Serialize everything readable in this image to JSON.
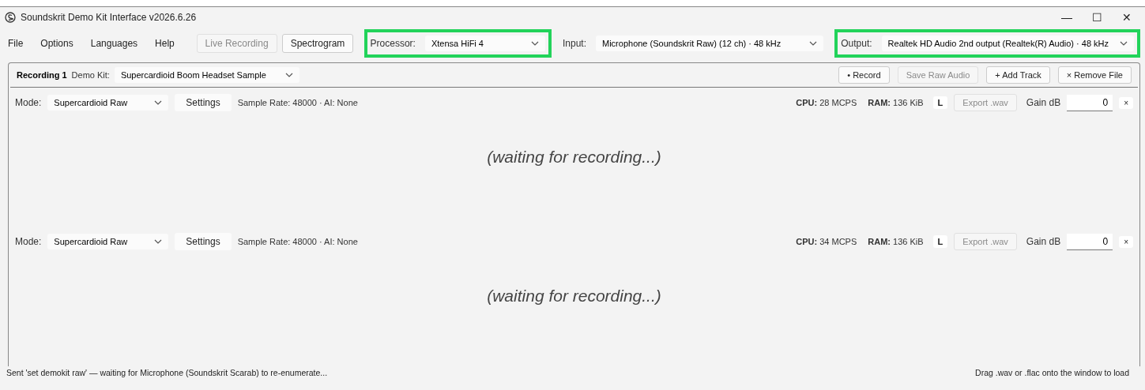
{
  "window": {
    "title": "Soundskrit Demo Kit Interface v2026.6.26",
    "controls": [
      "—",
      "☐",
      "✕"
    ]
  },
  "menu": [
    "File",
    "Options",
    "Languages",
    "Help"
  ],
  "toolbar_buttons": [
    {
      "label": "Live Recording",
      "disabled": true
    },
    {
      "label": "Spectrogram",
      "disabled": false
    }
  ],
  "device_selectors": [
    {
      "label": "Processor:",
      "value": "Xtensa HiFi 4",
      "highlighted": true
    },
    {
      "label": "Input:",
      "value": "Microphone (Soundskrit Raw)  (12 ch) · 48 kHz",
      "highlighted": false
    },
    {
      "label": "Output:",
      "value": "Realtek HD Audio 2nd output (Realtek(R) Audio) · 48 kHz",
      "highlighted": true
    }
  ],
  "recording": {
    "tab": "Recording 1",
    "kit_label": "Demo Kit:",
    "kit_value": "Supercardioid Boom Headset Sample",
    "actions": [
      {
        "label": "• Record",
        "disabled": false
      },
      {
        "label": "Save Raw Audio",
        "disabled": true
      },
      {
        "label": "+ Add Track",
        "disabled": false
      },
      {
        "label": "× Remove File",
        "disabled": false
      }
    ],
    "tracks": [
      {
        "mode_label": "Mode:",
        "mode": "Supercardioid Raw",
        "settings": "Settings",
        "info": "Sample Rate: 48000 · AI: None",
        "cpu": "**CPU:** 28 MCPS",
        "ram": "**RAM:** 136 KiB",
        "channel": "L",
        "export": {
          "label": "Export .wav",
          "disabled": true
        },
        "gain_label": "Gain dB",
        "gain": "0",
        "remove": "×",
        "placeholder_text": "(waiting for recording...)"
      },
      {
        "mode_label": "Mode:",
        "mode": "Supercardioid Raw",
        "settings": "Settings",
        "info": "Sample Rate: 48000 · AI: None",
        "cpu": "**CPU:** 34 MCPS",
        "ram": "**RAM:** 136 KiB",
        "channel": "L",
        "export": {
          "label": "Export .wav",
          "disabled": true
        },
        "gain_label": "Gain dB",
        "gain": "0",
        "remove": "×",
        "placeholder_text": "(waiting for recording...)"
      }
    ]
  },
  "status_bar": {
    "message": "Sent 'set demokit raw' — waiting for Microphone (Soundskrit Scarab) to re-enumerate...",
    "hint": "Drag .wav or .flac onto the window to load"
  }
}
